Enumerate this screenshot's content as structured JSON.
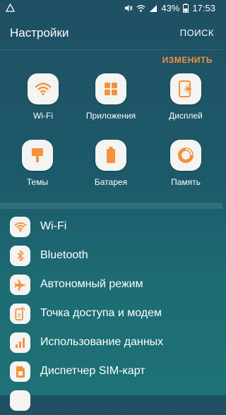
{
  "status_bar": {
    "battery_percent": "43%",
    "time": "17:53"
  },
  "header": {
    "title": "Настройки",
    "search_label": "ПОИСК"
  },
  "quick_settings": {
    "edit_label": "ИЗМЕНИТЬ",
    "tiles": [
      {
        "label": "Wi-Fi",
        "icon": "wifi-icon"
      },
      {
        "label": "Приложения",
        "icon": "apps-grid-icon"
      },
      {
        "label": "Дисплей",
        "icon": "display-icon"
      },
      {
        "label": "Темы",
        "icon": "brush-icon"
      },
      {
        "label": "Батарея",
        "icon": "battery-icon"
      },
      {
        "label": "Память",
        "icon": "memory-icon"
      }
    ]
  },
  "settings_list": [
    {
      "label": "Wi-Fi",
      "icon": "wifi-icon"
    },
    {
      "label": "Bluetooth",
      "icon": "bluetooth-icon"
    },
    {
      "label": "Автономный режим",
      "icon": "airplane-icon"
    },
    {
      "label": "Точка доступа и модем",
      "icon": "hotspot-icon"
    },
    {
      "label": "Использование данных",
      "icon": "data-usage-icon"
    },
    {
      "label": "Диспетчер SIM-карт",
      "icon": "sim-card-icon"
    }
  ],
  "colors": {
    "accent": "#f5913b",
    "icon_bg": "#f4f4f2",
    "bg_top": "#1f4f63",
    "bg_bottom": "#1e7276"
  }
}
